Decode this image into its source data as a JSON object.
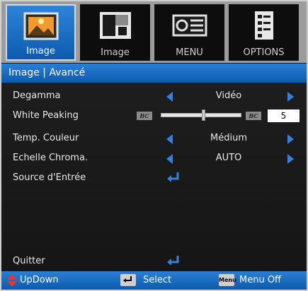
{
  "tabs": [
    {
      "label": "Image",
      "icon": "image-landscape-icon",
      "active": true
    },
    {
      "label": "Image",
      "icon": "image-blocks-icon",
      "active": false
    },
    {
      "label": "MENU",
      "icon": "projector-icon",
      "active": false
    },
    {
      "label": "OPTIONS",
      "icon": "document-checklist-icon",
      "active": false
    }
  ],
  "header": {
    "title": "Image | Avancé"
  },
  "items": {
    "degamma": {
      "label": "Degamma",
      "value": "Vidéo"
    },
    "white_peaking": {
      "label": "White Peaking",
      "value": "5",
      "level_fraction": 0.5,
      "badge": "BC"
    },
    "temp_couleur": {
      "label": "Temp. Couleur",
      "value": "Médium"
    },
    "echelle": {
      "label": "Echelle Chroma.",
      "value": "AUTO"
    },
    "source": {
      "label": "Source d'Entrée"
    },
    "quit": {
      "label": "Quitter"
    }
  },
  "footer": {
    "updown": "UpDown",
    "select": "Select",
    "menu_key": "Menu",
    "menu_off": "Menu Off"
  },
  "colors": {
    "accent": "#1f6fc5",
    "arrow": "#2f82e0",
    "background": "#1b1b1b"
  }
}
